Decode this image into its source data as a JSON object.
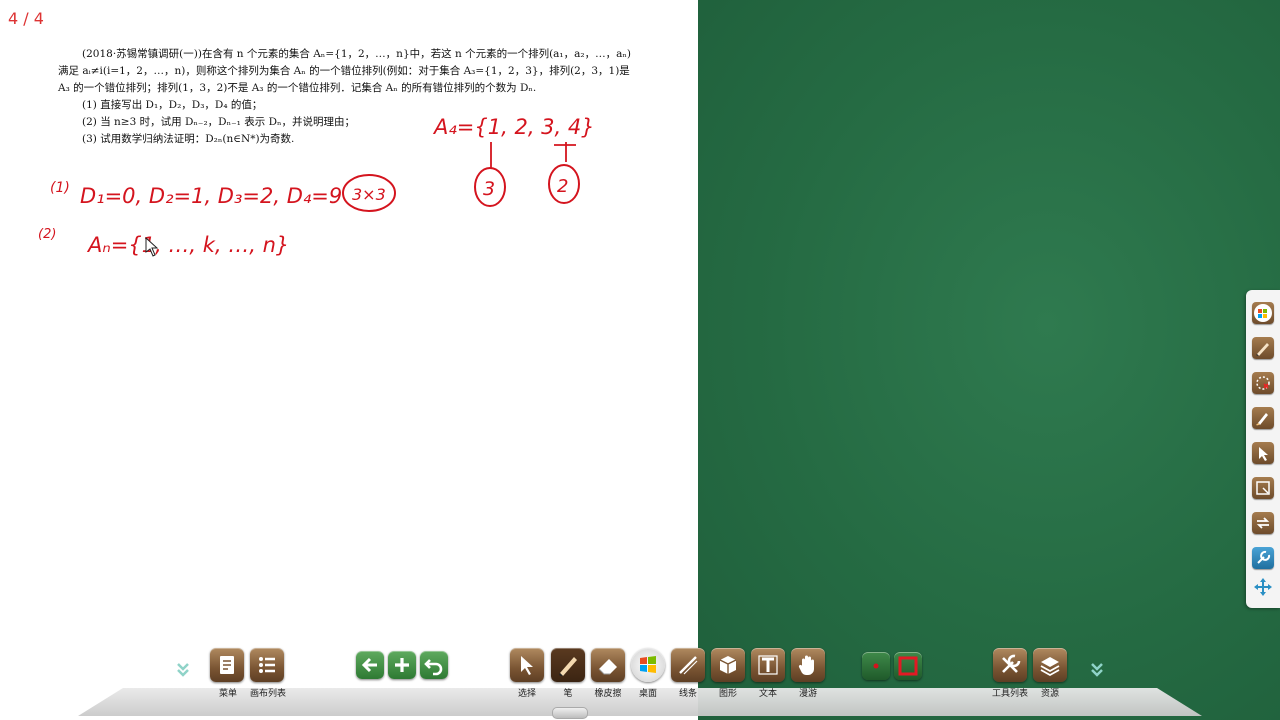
{
  "page_indicator": "4 / 4",
  "problem": {
    "intro": "(2018·苏锡常镇调研(一))在含有 n 个元素的集合 Aₙ={1，2，…，n}中，若这 n 个元素的一个排列(a₁，a₂，…，aₙ)满足 aᵢ≠i(i=1，2，…，n)，则称这个排列为集合 Aₙ 的一个错位排列(例如：对于集合 A₃={1，2，3}，排列(2，3，1)是 A₃ 的一个错位排列；排列(1，3，2)不是 A₃ 的一个错位排列．记集合 Aₙ 的所有错位排列的个数为 Dₙ.",
    "q1": "(1) 直接写出 D₁，D₂，D₃，D₄ 的值；",
    "q2": "(2) 当 n≥3 时，试用 Dₙ₋₂，Dₙ₋₁ 表示 Dₙ，并说明理由；",
    "q3": "(3) 试用数学归纳法证明：D₂ₙ(n∈N*)为奇数."
  },
  "handwriting": {
    "line1_label": "(1)",
    "line1": "D₁=0, D₂=1, D₃=2, D₄=9",
    "circled_note": "3×3",
    "line2_label": "(2)",
    "line2": "Aₙ={1, …, k, …, n}",
    "set_a4": "A₄={1, 2, 3, 4}",
    "circle_a": "3",
    "circle_b": "2"
  },
  "toolbar": {
    "menu": "菜单",
    "canvas_list": "画布列表",
    "select": "选择",
    "pen": "笔",
    "eraser": "橡皮擦",
    "desktop": "桌面",
    "line": "线条",
    "shape": "图形",
    "text": "文本",
    "roam": "漫游",
    "tool_list": "工具列表",
    "resources": "资源"
  },
  "colors": {
    "ink": "#d4141e",
    "board_green": "#256b43",
    "button_brown": "#7a5533"
  }
}
